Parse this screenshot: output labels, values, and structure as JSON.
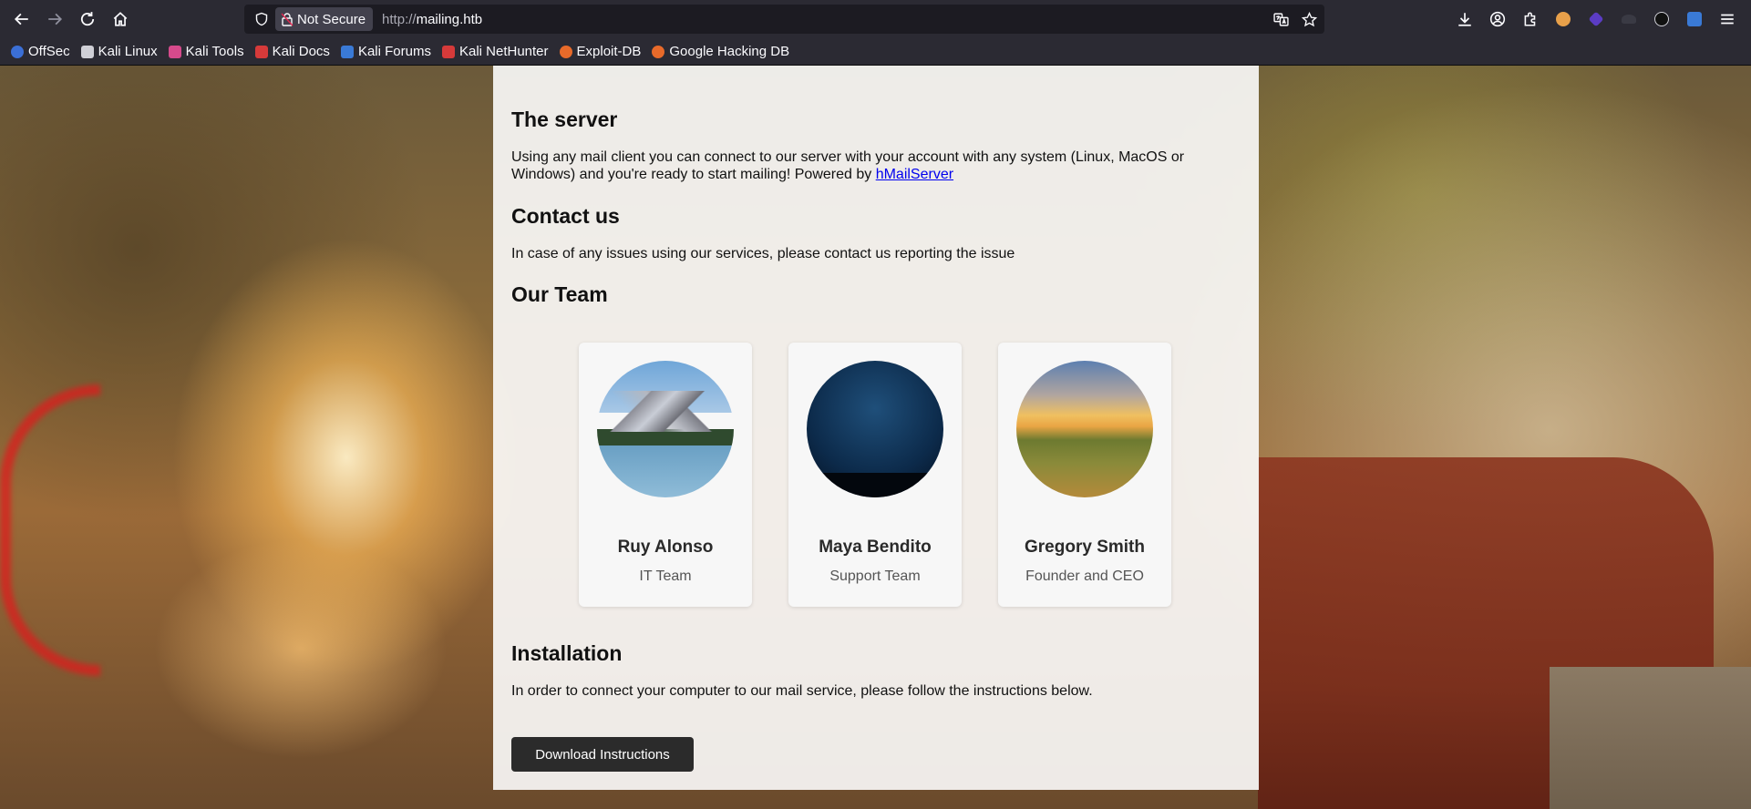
{
  "browser": {
    "security_label": "Not Secure",
    "url_protocol": "http://",
    "url_host": "mailing.htb"
  },
  "bookmarks": [
    {
      "label": "OffSec",
      "icon": "offsec-icon",
      "color": "#3b6fd6"
    },
    {
      "label": "Kali Linux",
      "icon": "kali-dragon-icon",
      "color": "#cfcfd6"
    },
    {
      "label": "Kali Tools",
      "icon": "kali-tools-icon",
      "color": "#d64a8c"
    },
    {
      "label": "Kali Docs",
      "icon": "kali-docs-icon",
      "color": "#d63a3a"
    },
    {
      "label": "Kali Forums",
      "icon": "kali-forums-icon",
      "color": "#3a7ad6"
    },
    {
      "label": "Kali NetHunter",
      "icon": "nethunter-icon",
      "color": "#d63a3a"
    },
    {
      "label": "Exploit-DB",
      "icon": "exploit-db-icon",
      "color": "#e86a2a"
    },
    {
      "label": "Google Hacking DB",
      "icon": "ghdb-icon",
      "color": "#e86a2a"
    }
  ],
  "server": {
    "heading": "The server",
    "text": "Using any mail client you can connect to our server with your account with any system (Linux, MacOS or Windows) and you're ready to start mailing! Powered by ",
    "link": "hMailServer"
  },
  "contact": {
    "heading": "Contact us",
    "text": "In case of any issues using our services, please contact us reporting the issue"
  },
  "team": {
    "heading": "Our Team",
    "members": [
      {
        "name": "Ruy Alonso",
        "role": "IT Team"
      },
      {
        "name": "Maya Bendito",
        "role": "Support Team"
      },
      {
        "name": "Gregory Smith",
        "role": "Founder and CEO"
      }
    ]
  },
  "installation": {
    "heading": "Installation",
    "text": "In order to connect your computer to our mail service, please follow the instructions below.",
    "button": "Download Instructions"
  }
}
